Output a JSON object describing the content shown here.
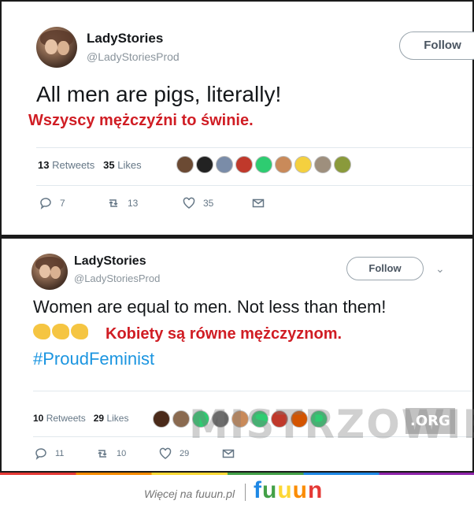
{
  "tweet1": {
    "name": "LadyStories",
    "handle": "@LadyStoriesProd",
    "follow_label": "Follow",
    "text": "All men are pigs, literally!",
    "translation": "Wszyscy mężczyźni to świnie.",
    "retweets_count": "13",
    "retweets_label": "Retweets",
    "likes_count": "35",
    "likes_label": "Likes",
    "replies": "7",
    "retweets_action": "13",
    "likes_action": "35",
    "liker_colors": [
      "#6b4a33",
      "#222222",
      "#7a8ca8",
      "#c0392b",
      "#2ecc71",
      "#c98a5a",
      "#f4d03f",
      "#9e8f7d",
      "#8a9a3b"
    ]
  },
  "tweet2": {
    "name": "LadyStories",
    "handle": "@LadyStoriesProd",
    "follow_label": "Follow",
    "text": "Women are equal to men. Not less than them!",
    "translation": "Kobiety są równe mężczyznom.",
    "hashtag": "#ProudFeminist",
    "retweets_count": "10",
    "retweets_label": "Retweets",
    "likes_count": "29",
    "likes_label": "Likes",
    "replies": "11",
    "retweets_action": "10",
    "likes_action": "29",
    "liker_colors": [
      "#4a2a1a",
      "#8a6a50",
      "#2ecc71",
      "#666666",
      "#c98a5a",
      "#2ecc71",
      "#c0392b",
      "#d35400",
      "#2ecc71"
    ]
  },
  "watermark": {
    "text": "MISTRZOWIE",
    "suffix": ".ORG"
  },
  "footer": {
    "more_text": "Więcej na fuuun.pl",
    "logo_letters": [
      "f",
      "u",
      "u",
      "u",
      "n"
    ],
    "logo_colors": [
      "#1e88e5",
      "#43a047",
      "#fdd835",
      "#fb8c00",
      "#e53935"
    ]
  }
}
